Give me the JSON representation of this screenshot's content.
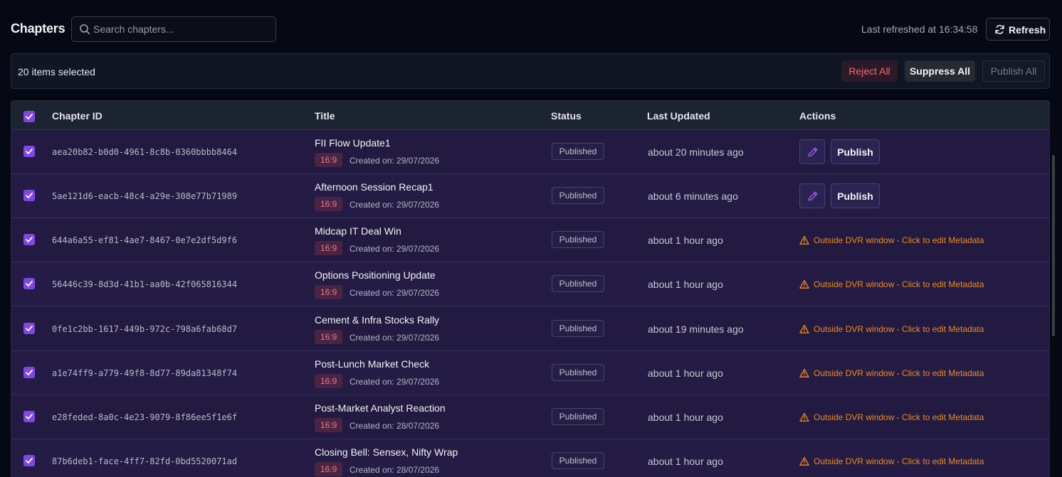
{
  "header": {
    "title": "Chapters",
    "search_placeholder": "Search chapters...",
    "last_refreshed": "Last refreshed at 16:34:58",
    "refresh_label": "Refresh"
  },
  "selection_bar": {
    "count_text": "20 items selected",
    "reject_all": "Reject All",
    "suppress_all": "Suppress All",
    "publish_all": "Publish All"
  },
  "table": {
    "columns": {
      "chapter_id": "Chapter ID",
      "title": "Title",
      "status": "Status",
      "last_updated": "Last Updated",
      "actions": "Actions"
    },
    "rows": [
      {
        "id": "aea20b82-b0d0-4961-8c8b-0360bbbb8464",
        "title": "FII Flow Update1",
        "ratio": "16:9",
        "created": "Created on: 29/07/2026",
        "status": "Published",
        "updated": "about 20 minutes ago",
        "action": "Publish",
        "checked": true
      },
      {
        "id": "5ae121d6-eacb-48c4-a29e-308e77b71989",
        "title": "Afternoon Session Recap1",
        "ratio": "16:9",
        "created": "Created on: 29/07/2026",
        "status": "Published",
        "updated": "about 6 minutes ago",
        "action": "Publish",
        "checked": true
      },
      {
        "id": "644a6a55-ef81-4ae7-8467-0e7e2df5d9f6",
        "title": "Midcap IT Deal Win",
        "ratio": "16:9",
        "created": "Created on: 29/07/2026",
        "status": "Published",
        "updated": "about 1 hour ago",
        "action": "Outside DVR window - Click to edit Metadata",
        "checked": true
      },
      {
        "id": "56446c39-8d3d-41b1-aa0b-42f065816344",
        "title": "Options Positioning Update",
        "ratio": "16:9",
        "created": "Created on: 29/07/2026",
        "status": "Published",
        "updated": "about 1 hour ago",
        "action": "Outside DVR window - Click to edit Metadata",
        "checked": true
      },
      {
        "id": "0fe1c2bb-1617-449b-972c-798a6fab68d7",
        "title": "Cement & Infra Stocks Rally",
        "ratio": "16:9",
        "created": "Created on: 29/07/2026",
        "status": "Published",
        "updated": "about 19 minutes ago",
        "action": "Outside DVR window - Click to edit Metadata",
        "checked": true
      },
      {
        "id": "a1e74ff9-a779-49f8-8d77-89da81348f74",
        "title": "Post-Lunch Market Check",
        "ratio": "16:9",
        "created": "Created on: 29/07/2026",
        "status": "Published",
        "updated": "about 1 hour ago",
        "action": "Outside DVR window - Click to edit Metadata",
        "checked": true
      },
      {
        "id": "e28feded-8a0c-4e23-9079-8f86ee5f1e6f",
        "title": "Post-Market Analyst Reaction",
        "ratio": "16:9",
        "created": "Created on: 28/07/2026",
        "status": "Published",
        "updated": "about 1 hour ago",
        "action": "Outside DVR window - Click to edit Metadata",
        "checked": true
      },
      {
        "id": "87b6deb1-face-4ff7-82fd-0bd5520071ad",
        "title": "Closing Bell: Sensex, Nifty Wrap",
        "ratio": "16:9",
        "created": "Created on: 28/07/2026",
        "status": "Published",
        "updated": "about 1 hour ago",
        "action": "Outside DVR window - Click to edit Metadata",
        "checked": true
      }
    ]
  },
  "colors": {
    "accent": "#7f48e6",
    "warning": "#ee8b1c",
    "danger": "#f26b78"
  }
}
